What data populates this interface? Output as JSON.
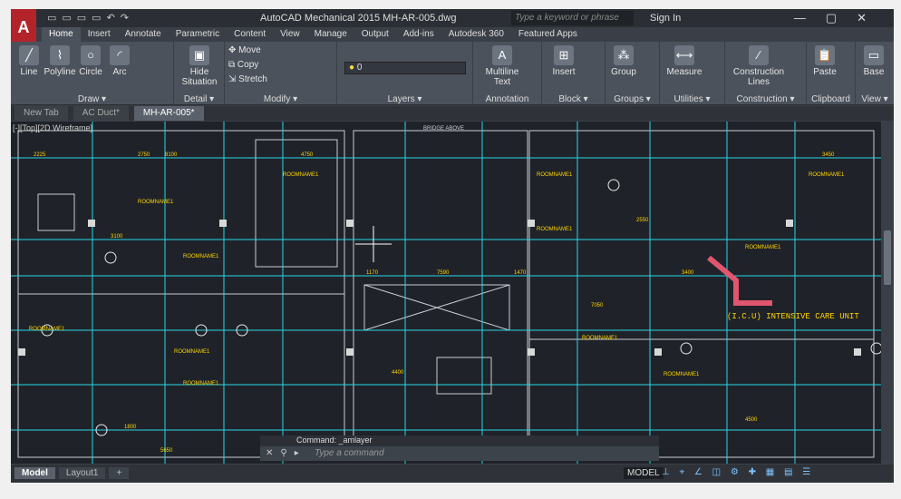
{
  "titlebar": {
    "logo": "A",
    "title": "AutoCAD Mechanical 2015   MH-AR-005.dwg",
    "search_placeholder": "Type a keyword or phrase",
    "sign_in": "Sign In"
  },
  "ribbon_tabs": [
    "Home",
    "Insert",
    "Annotate",
    "Parametric",
    "Content",
    "View",
    "Manage",
    "Output",
    "Add-ins",
    "Autodesk 360",
    "Featured Apps"
  ],
  "panels": {
    "draw": {
      "title": "Draw ▾",
      "tools": [
        "Line",
        "Polyline",
        "Circle",
        "Arc"
      ]
    },
    "detail": {
      "title": "Detail ▾",
      "tools": [
        "Hide Situation"
      ]
    },
    "modify": {
      "title": "Modify ▾",
      "tools": [
        "Move",
        "Copy",
        "Stretch"
      ]
    },
    "layers": {
      "title": "Layers ▾",
      "layer_value": "0"
    },
    "annotation": {
      "title": "Annotation",
      "tools": [
        "Multiline Text"
      ]
    },
    "block": {
      "title": "Block ▾",
      "tools": [
        "Insert"
      ]
    },
    "groups": {
      "title": "Groups ▾",
      "tools": [
        "Group"
      ]
    },
    "utilities": {
      "title": "Utilities ▾",
      "tools": [
        "Measure"
      ]
    },
    "construction": {
      "title": "Construction ▾",
      "tools": [
        "Construction Lines"
      ]
    },
    "clipboard": {
      "title": "Clipboard",
      "tools": [
        "Paste"
      ]
    },
    "view": {
      "title": "View ▾",
      "tools": [
        "Base"
      ]
    }
  },
  "doc_tabs": [
    "New Tab",
    "AC Duct*",
    "MH-AR-005*"
  ],
  "viewport_label": "[-][Top][2D Wireframe]",
  "drawing": {
    "header": "BRIDGE ABOVE",
    "icu_label": "(I.C.U) INTENSIVE CARE UNIT",
    "room_label": "ROOMNAME1",
    "dims": [
      "4750",
      "2750",
      "3100",
      "1170",
      "7590",
      "1470",
      "3400",
      "7050",
      "4400",
      "4500",
      "1800",
      "5650",
      "2550",
      "3450",
      "8100",
      "2225"
    ]
  },
  "command": {
    "history": "Command: _amlayer",
    "placeholder": "Type a command"
  },
  "layout_tabs": [
    "Model",
    "Layout1",
    "+"
  ],
  "status": {
    "model": "MODEL"
  }
}
